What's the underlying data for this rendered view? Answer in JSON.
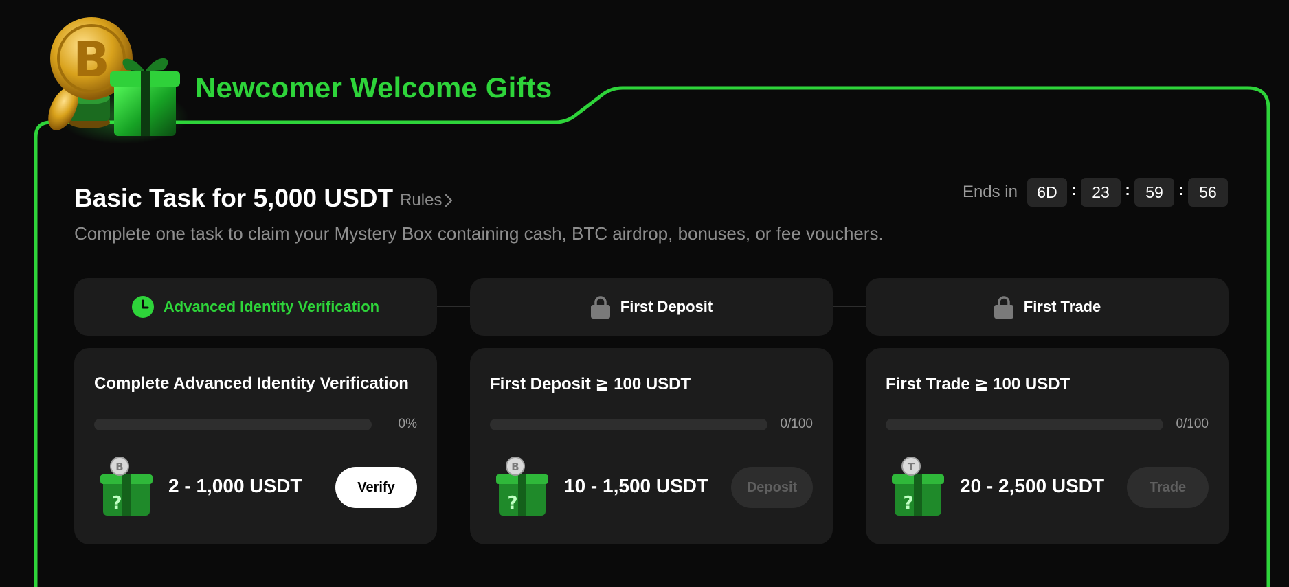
{
  "banner": {
    "title": "Newcomer Welcome Gifts"
  },
  "header": {
    "title": "Basic Task for 5,000 USDT",
    "rules_label": "Rules",
    "subtitle": "Complete one task to claim your Mystery Box containing cash, BTC airdrop, bonuses, or fee vouchers."
  },
  "countdown": {
    "label": "Ends in",
    "days": "6D",
    "hours": "23",
    "minutes": "59",
    "seconds": "56"
  },
  "steps": [
    {
      "label": "Advanced Identity Verification",
      "status": "in-progress",
      "icon": "clock-icon"
    },
    {
      "label": "First Deposit",
      "status": "locked",
      "icon": "lock-icon"
    },
    {
      "label": "First Trade",
      "status": "locked",
      "icon": "lock-icon"
    }
  ],
  "tasks": [
    {
      "title": "Complete Advanced Identity Verification",
      "progress_text": "0%",
      "progress": 0,
      "reward": "2 - 1,000 USDT",
      "button": "Verify",
      "button_enabled": true,
      "coin": "bitcoin"
    },
    {
      "title": "First Deposit ≧ 100 USDT",
      "progress_text": "0/100",
      "progress": 0,
      "reward": "10 - 1,500 USDT",
      "button": "Deposit",
      "button_enabled": false,
      "coin": "bitcoin"
    },
    {
      "title": "First Trade ≧ 100 USDT",
      "progress_text": "0/100",
      "progress": 0,
      "reward": "20 - 2,500 USDT",
      "button": "Trade",
      "button_enabled": false,
      "coin": "tether"
    }
  ],
  "colors": {
    "accent": "#2ed43a",
    "background": "#0a0a0a",
    "card": "#1c1c1c",
    "muted_text": "#8e8e8e"
  }
}
